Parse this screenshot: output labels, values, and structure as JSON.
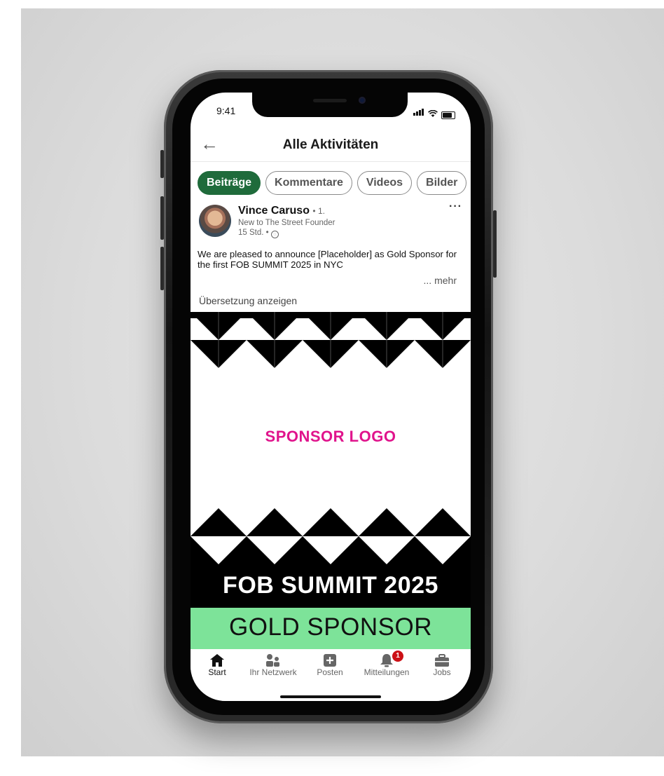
{
  "status_bar": {
    "time": "9:41"
  },
  "header": {
    "title": "Alle Aktivitäten",
    "back_icon": "arrow-left-icon"
  },
  "tabs": [
    {
      "label": "Beiträge",
      "active": true
    },
    {
      "label": "Kommentare",
      "active": false
    },
    {
      "label": "Videos",
      "active": false
    },
    {
      "label": "Bilder",
      "active": false
    }
  ],
  "post": {
    "author": "Vince Caruso",
    "degree": "• 1.",
    "subtitle": "New to The Street Founder",
    "time": "15 Std. •",
    "text": "We are pleased to announce [Placeholder] as Gold Sponsor for the first FOB SUMMIT 2025 in NYC",
    "more_label": "... mehr",
    "translate_label": "Übersetzung anzeigen",
    "image": {
      "sponsor_logo": "SPONSOR LOGO",
      "summit": "FOB SUMMIT 2025",
      "gold": "GOLD SPONSOR"
    }
  },
  "nav": {
    "items": [
      {
        "label": "Start",
        "icon": "home-icon"
      },
      {
        "label": "Ihr Netzwerk",
        "icon": "network-icon"
      },
      {
        "label": "Posten",
        "icon": "plus-square-icon"
      },
      {
        "label": "Mitteilungen",
        "icon": "bell-icon",
        "badge": "1"
      },
      {
        "label": "Jobs",
        "icon": "briefcase-icon"
      }
    ]
  },
  "colors": {
    "accent_green": "#1f6b3b",
    "sponsor_magenta": "#e0148c",
    "gold_bar_green": "#7de399",
    "badge_red": "#cc1016"
  }
}
